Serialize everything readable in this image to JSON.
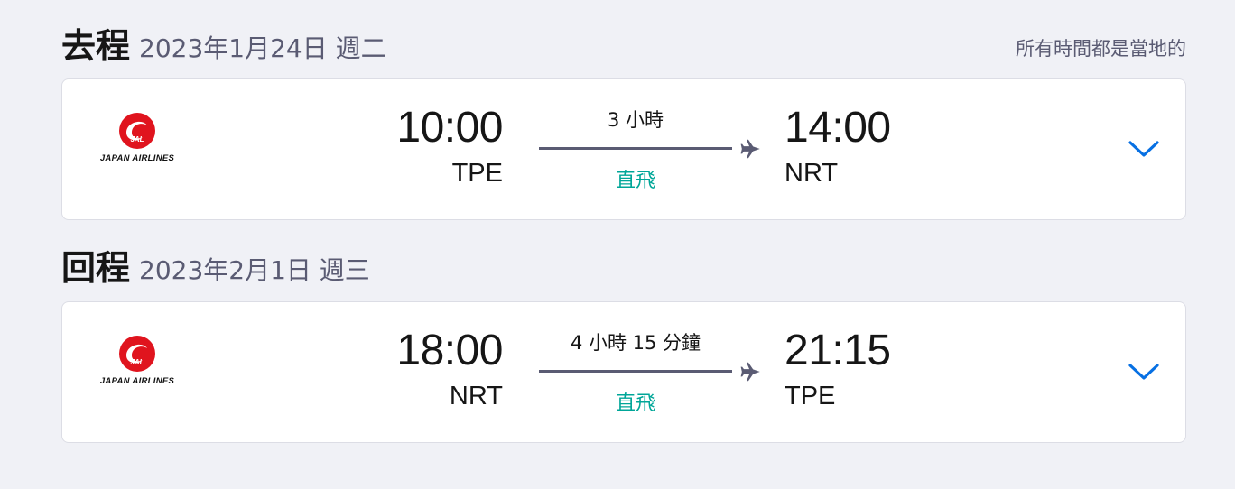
{
  "note": "所有時間都是當地的",
  "legs": [
    {
      "label": "去程",
      "date": "2023年1月24日 週二",
      "airline_logo_text": "JAPAN AIRLINES",
      "airline_mark": "JAL",
      "dep_time": "10:00",
      "dep_code": "TPE",
      "duration": "3 小時",
      "stops": "直飛",
      "arr_time": "14:00",
      "arr_code": "NRT"
    },
    {
      "label": "回程",
      "date": "2023年2月1日 週三",
      "airline_logo_text": "JAPAN AIRLINES",
      "airline_mark": "JAL",
      "dep_time": "18:00",
      "dep_code": "NRT",
      "duration": "4 小時 15 分鐘",
      "stops": "直飛",
      "arr_time": "21:15",
      "arr_code": "TPE"
    }
  ],
  "colors": {
    "accent": "#0770e3",
    "stops": "#00a698",
    "secondary_text": "#5a5b73",
    "airline_red": "#e0141e"
  },
  "icons": {
    "logo": "jal-crane-icon",
    "plane": "plane-icon",
    "expand": "chevron-down-icon"
  }
}
